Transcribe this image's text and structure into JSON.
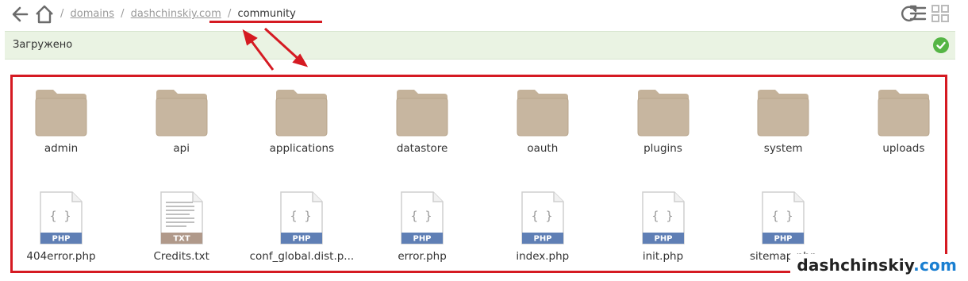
{
  "breadcrumb": {
    "items": [
      "domains",
      "dashchinskiy.com"
    ],
    "current": "community",
    "separator": "/"
  },
  "status": {
    "text": "Загружено",
    "ok_color": "#55b545"
  },
  "icons": {
    "back": "arrow-left-icon",
    "home": "home-icon",
    "refresh": "refresh-icon",
    "list_view": "list-view-icon",
    "grid_view": "grid-view-icon",
    "folder": "folder-icon",
    "php_file": "php-file-icon",
    "txt_file": "txt-file-icon"
  },
  "folders": [
    {
      "name": "admin"
    },
    {
      "name": "api"
    },
    {
      "name": "applications"
    },
    {
      "name": "datastore"
    },
    {
      "name": "oauth"
    },
    {
      "name": "plugins"
    },
    {
      "name": "system"
    },
    {
      "name": "uploads"
    }
  ],
  "files": [
    {
      "name": "404error.php",
      "type": "PHP"
    },
    {
      "name": "Credits.txt",
      "type": "TXT"
    },
    {
      "name": "conf_global.dist.p...",
      "type": "PHP"
    },
    {
      "name": "error.php",
      "type": "PHP"
    },
    {
      "name": "index.php",
      "type": "PHP"
    },
    {
      "name": "init.php",
      "type": "PHP"
    },
    {
      "name": "sitemap.php",
      "type": "PHP"
    }
  ],
  "colors": {
    "folder": "#c4b29a",
    "php_band": "#5f7fb5",
    "txt_band": "#b0998a",
    "annotation": "#d51a22",
    "status_bg": "#eaf3e3"
  },
  "watermark": {
    "name": "dashchinskiy",
    "tld": ".com"
  }
}
